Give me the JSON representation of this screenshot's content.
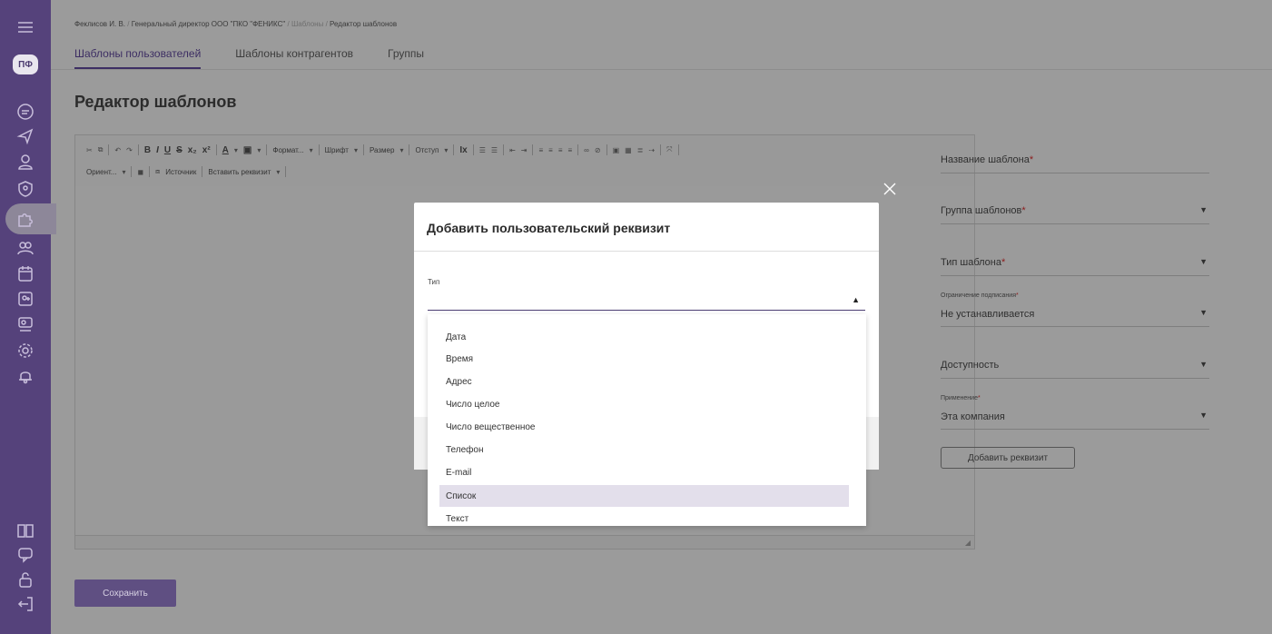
{
  "sidebar": {
    "avatar_text": "ПФ",
    "icons": [
      "menu-icon",
      "documents-icon",
      "send-icon",
      "user-icon",
      "shield-icon",
      "puzzle-icon",
      "group-icon",
      "calendar-icon",
      "add-user-icon",
      "people-icon",
      "settings-icon",
      "bell-icon",
      "book-icon",
      "chat-icon",
      "lock-icon",
      "logout-icon"
    ],
    "accent": "#55427b"
  },
  "breadcrumb": {
    "part1": "Феклисов И. В.",
    "sep": "/",
    "part2": "Генеральный директор ООО \"ПКО \"ФЕНИКС\"",
    "part3": "Шаблоны",
    "part4": "Редактор шаблонов"
  },
  "tabs": [
    {
      "label": "Шаблоны пользователей",
      "active": true
    },
    {
      "label": "Шаблоны контрагентов",
      "active": false
    },
    {
      "label": "Группы",
      "active": false
    }
  ],
  "page_title": "Редактор шаблонов",
  "toolbar": {
    "bold": "B",
    "italic": "I",
    "underline": "U",
    "strike": "S",
    "subscript": "x₂",
    "superscript": "x²",
    "text_color": "A",
    "bg_color": "▣",
    "format": "Формат...",
    "font": "Шрифт",
    "size": "Размер",
    "indent": "Отступ",
    "orient": "Ориент...",
    "source": "Источник",
    "insert_req": "Вставить реквизит"
  },
  "right_panel": {
    "template_name_label": "Название шаблона",
    "template_group_label": "Группа шаблонов",
    "template_type_label": "Тип шаблона",
    "sign_limit_label": "Ограничение подписания",
    "sign_limit_value": "Не устанавливается",
    "availability_label": "Доступность",
    "usage_label": "Применение",
    "usage_value": "Эта компания",
    "required_mark": "*",
    "add_requisite_button": "Добавить реквизит"
  },
  "save_button": "Сохранить",
  "modal": {
    "title": "Добавить пользовательский реквизит",
    "type_label": "Тип",
    "type_value": "",
    "options": [
      "Дата",
      "Время",
      "Адрес",
      "Число целое",
      "Число вещественное",
      "Телефон",
      "E-mail",
      "Список",
      "Текст"
    ],
    "selected_option": "Список"
  }
}
